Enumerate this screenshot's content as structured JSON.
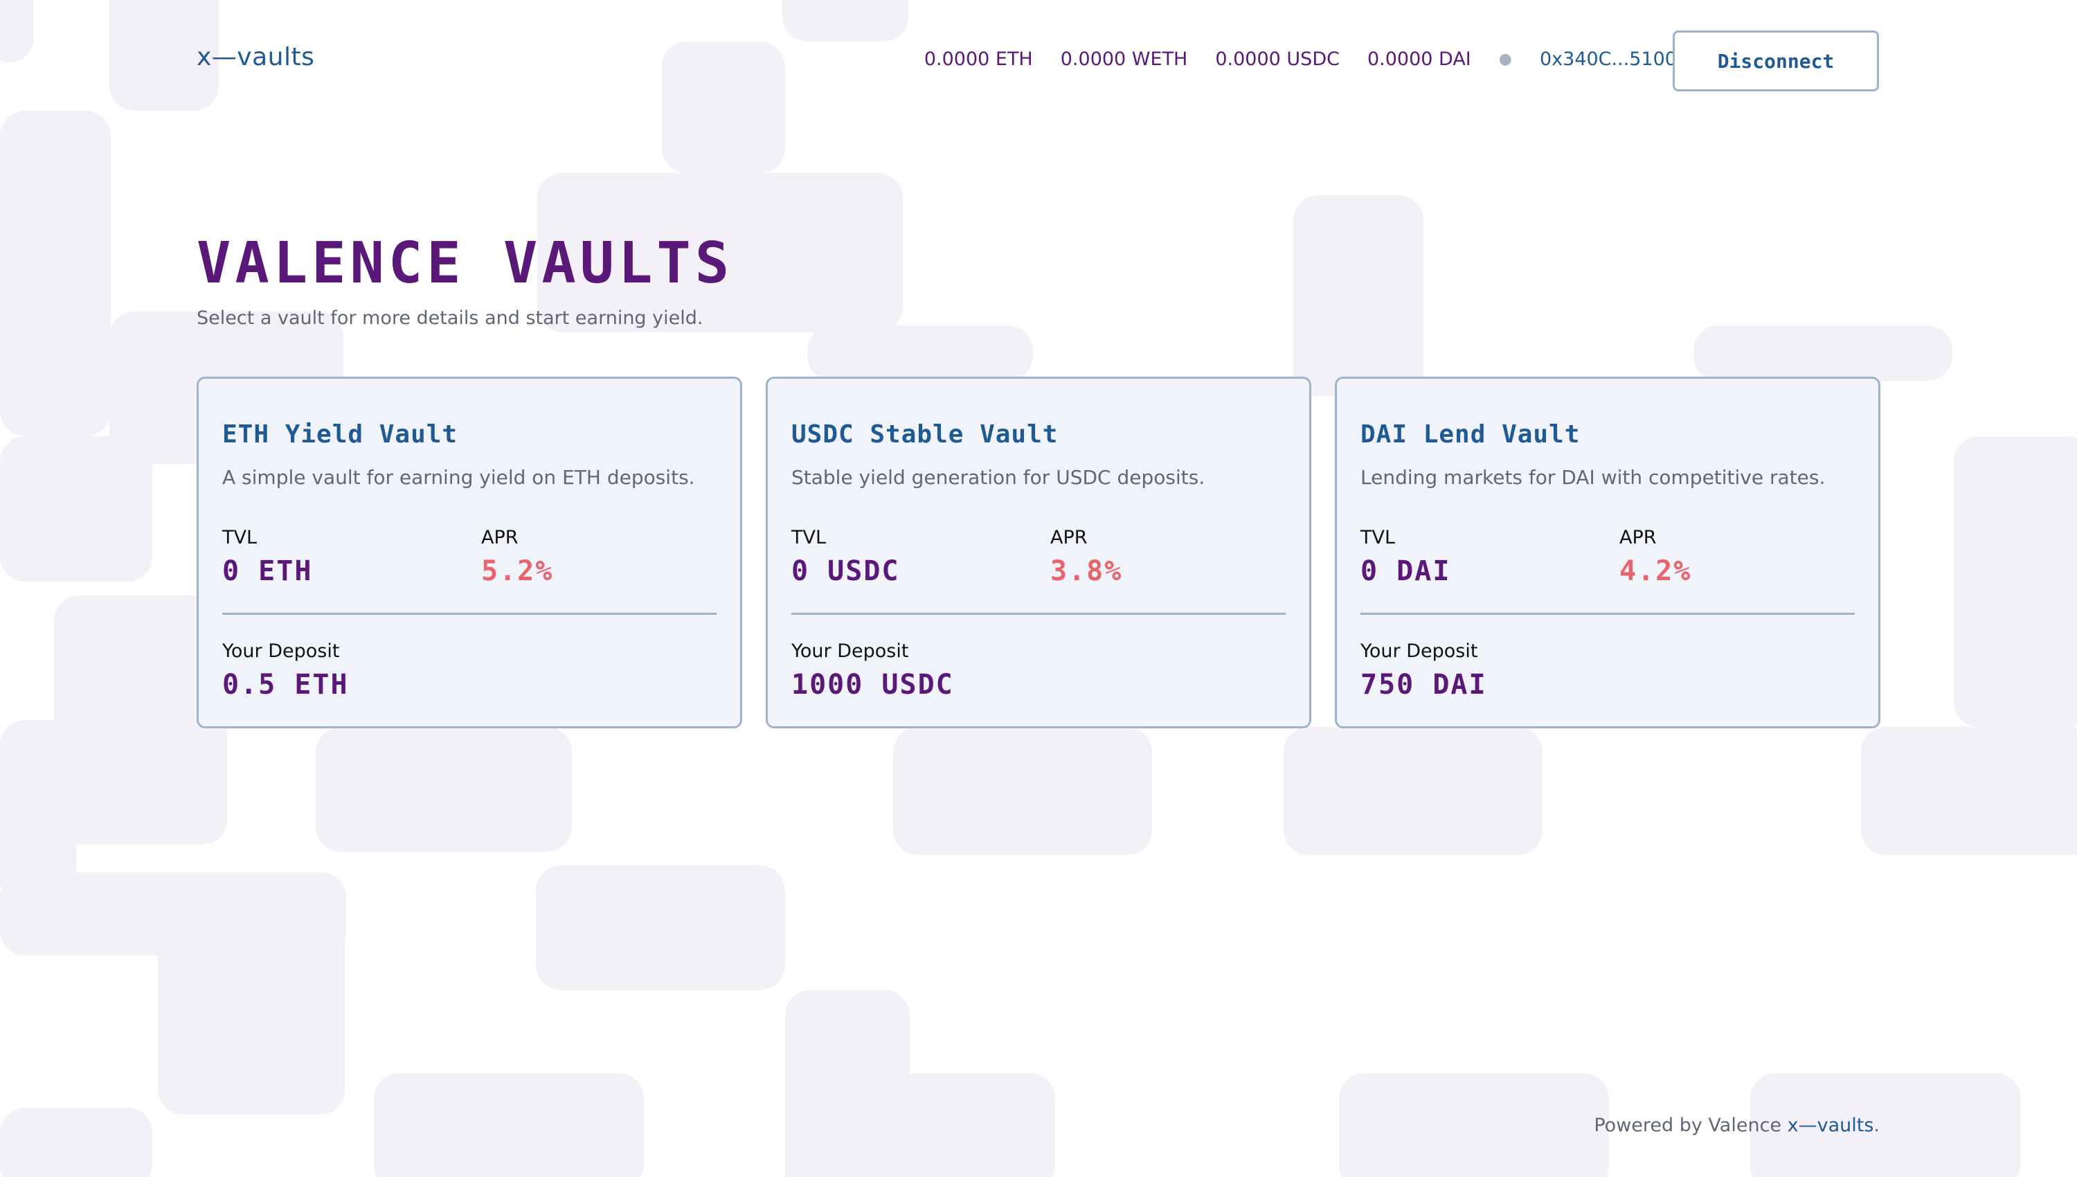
{
  "header": {
    "logo": "x—vaults",
    "balances": [
      "0.0000 ETH",
      "0.0000 WETH",
      "0.0000 USDC",
      "0.0000 DAI"
    ],
    "address": "0x340C...5100",
    "disconnect_label": "Disconnect"
  },
  "hero": {
    "title": "VALENCE VAULTS",
    "subtitle": "Select a vault for more details and start earning yield."
  },
  "vaults": [
    {
      "name": "ETH Yield Vault",
      "description": "A simple vault for earning yield on ETH deposits.",
      "tvl_label": "TVL",
      "tvl": "0 ETH",
      "apr_label": "APR",
      "apr": "5.2%",
      "deposit_label": "Your Deposit",
      "deposit": "0.5 ETH"
    },
    {
      "name": "USDC Stable Vault",
      "description": "Stable yield generation for USDC deposits.",
      "tvl_label": "TVL",
      "tvl": "0 USDC",
      "apr_label": "APR",
      "apr": "3.8%",
      "deposit_label": "Your Deposit",
      "deposit": "1000 USDC"
    },
    {
      "name": "DAI Lend Vault",
      "description": "Lending markets for DAI with competitive rates.",
      "tvl_label": "TVL",
      "tvl": "0 DAI",
      "apr_label": "APR",
      "apr": "4.2%",
      "deposit_label": "Your Deposit",
      "deposit": "750 DAI"
    }
  ],
  "footer": {
    "prefix": "Powered by Valence ",
    "link": "x—vaults",
    "suffix": "."
  },
  "colors": {
    "primary_purple": "#5a1878",
    "primary_blue": "#1f5a94",
    "apr_red": "#e8636b",
    "card_bg": "#f0f3f9",
    "card_border": "#9fb2cc",
    "background_pattern": "#f4f0f7"
  }
}
